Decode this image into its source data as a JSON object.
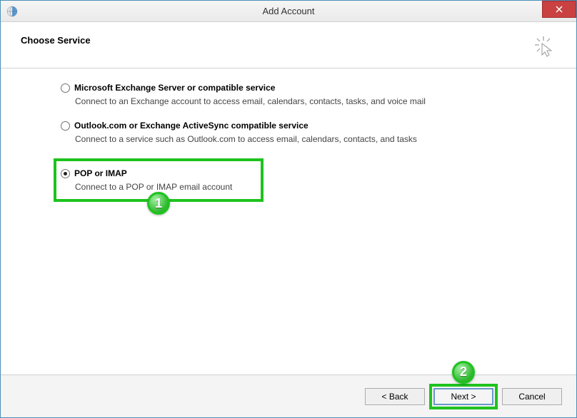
{
  "window": {
    "title": "Add Account"
  },
  "header": {
    "title": "Choose Service"
  },
  "options": [
    {
      "label": "Microsoft Exchange Server or compatible service",
      "description": "Connect to an Exchange account to access email, calendars, contacts, tasks, and voice mail",
      "selected": false
    },
    {
      "label": "Outlook.com or Exchange ActiveSync compatible service",
      "description": "Connect to a service such as Outlook.com to access email, calendars, contacts, and tasks",
      "selected": false
    },
    {
      "label": "POP or IMAP",
      "description": "Connect to a POP or IMAP email account",
      "selected": true
    }
  ],
  "annotations": {
    "step1": "1",
    "step2": "2"
  },
  "footer": {
    "back": "< Back",
    "next": "Next >",
    "cancel": "Cancel"
  }
}
